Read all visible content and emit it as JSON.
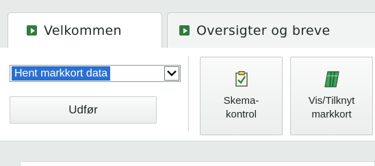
{
  "tabs": [
    {
      "label": "Velkommen",
      "icon": "arrow-right-icon",
      "active": true
    },
    {
      "label": "Oversigter og breve",
      "icon": "arrow-right-icon",
      "active": false
    }
  ],
  "toolbar": {
    "select": {
      "value": "Hent markkort data"
    },
    "run_label": "Udfør",
    "schema_check": {
      "line1": "Skema-",
      "line2": "kontrol",
      "icon": "clipboard-check-icon"
    },
    "markkort": {
      "line1": "Vis/Tilknyt",
      "line2": "markkort",
      "icon": "field-map-icon"
    }
  },
  "colors": {
    "accent_green": "#2e7d3c",
    "selection_blue": "#2a70d0",
    "background": "#e6ebe9"
  }
}
